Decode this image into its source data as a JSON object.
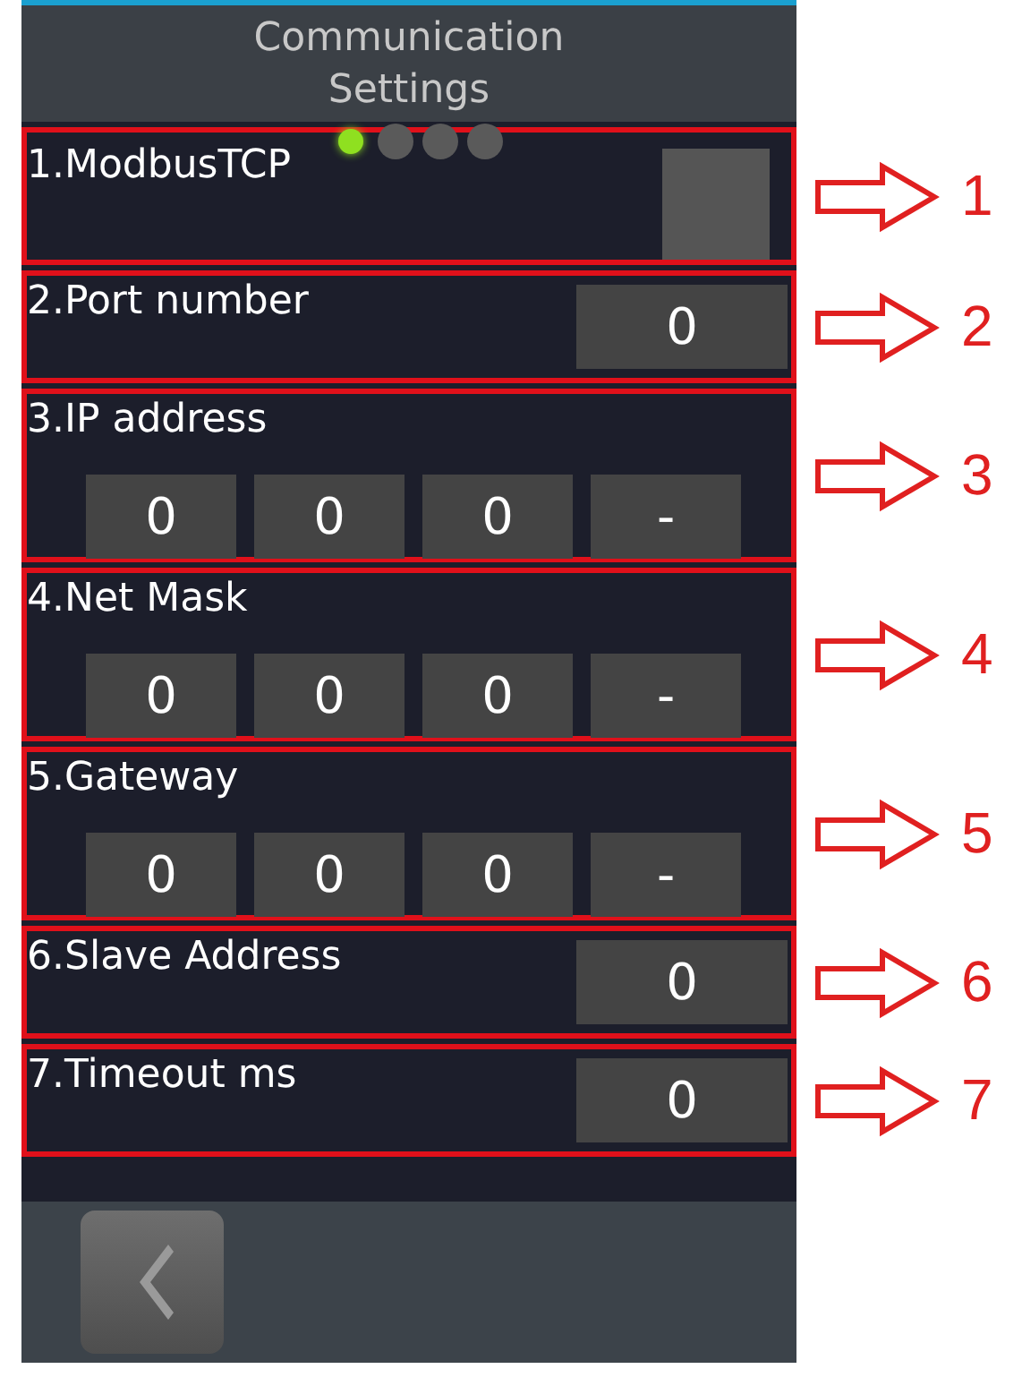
{
  "header": {
    "title": "Communication Settings"
  },
  "page_dots": [
    {
      "selected": true
    },
    {
      "selected": false
    },
    {
      "selected": false
    },
    {
      "selected": false
    }
  ],
  "sections": [
    {
      "kind": "checkbox",
      "label": "1.ModbusTCP",
      "checked": false,
      "callout": "1"
    },
    {
      "kind": "field",
      "label": "2.Port number",
      "value": "0",
      "callout": "2"
    },
    {
      "kind": "octets",
      "label": "3.IP address",
      "values": [
        "0",
        "0",
        "0",
        "-"
      ],
      "callout": "3"
    },
    {
      "kind": "octets",
      "label": "4.Net Mask",
      "values": [
        "0",
        "0",
        "0",
        "-"
      ],
      "callout": "4"
    },
    {
      "kind": "octets",
      "label": "5.Gateway",
      "values": [
        "0",
        "0",
        "0",
        "-"
      ],
      "callout": "5"
    },
    {
      "kind": "field",
      "label": "6.Slave Address",
      "value": "0",
      "callout": "6"
    },
    {
      "kind": "field",
      "label": "7.Timeout ms",
      "value": "0",
      "callout": "7"
    }
  ]
}
